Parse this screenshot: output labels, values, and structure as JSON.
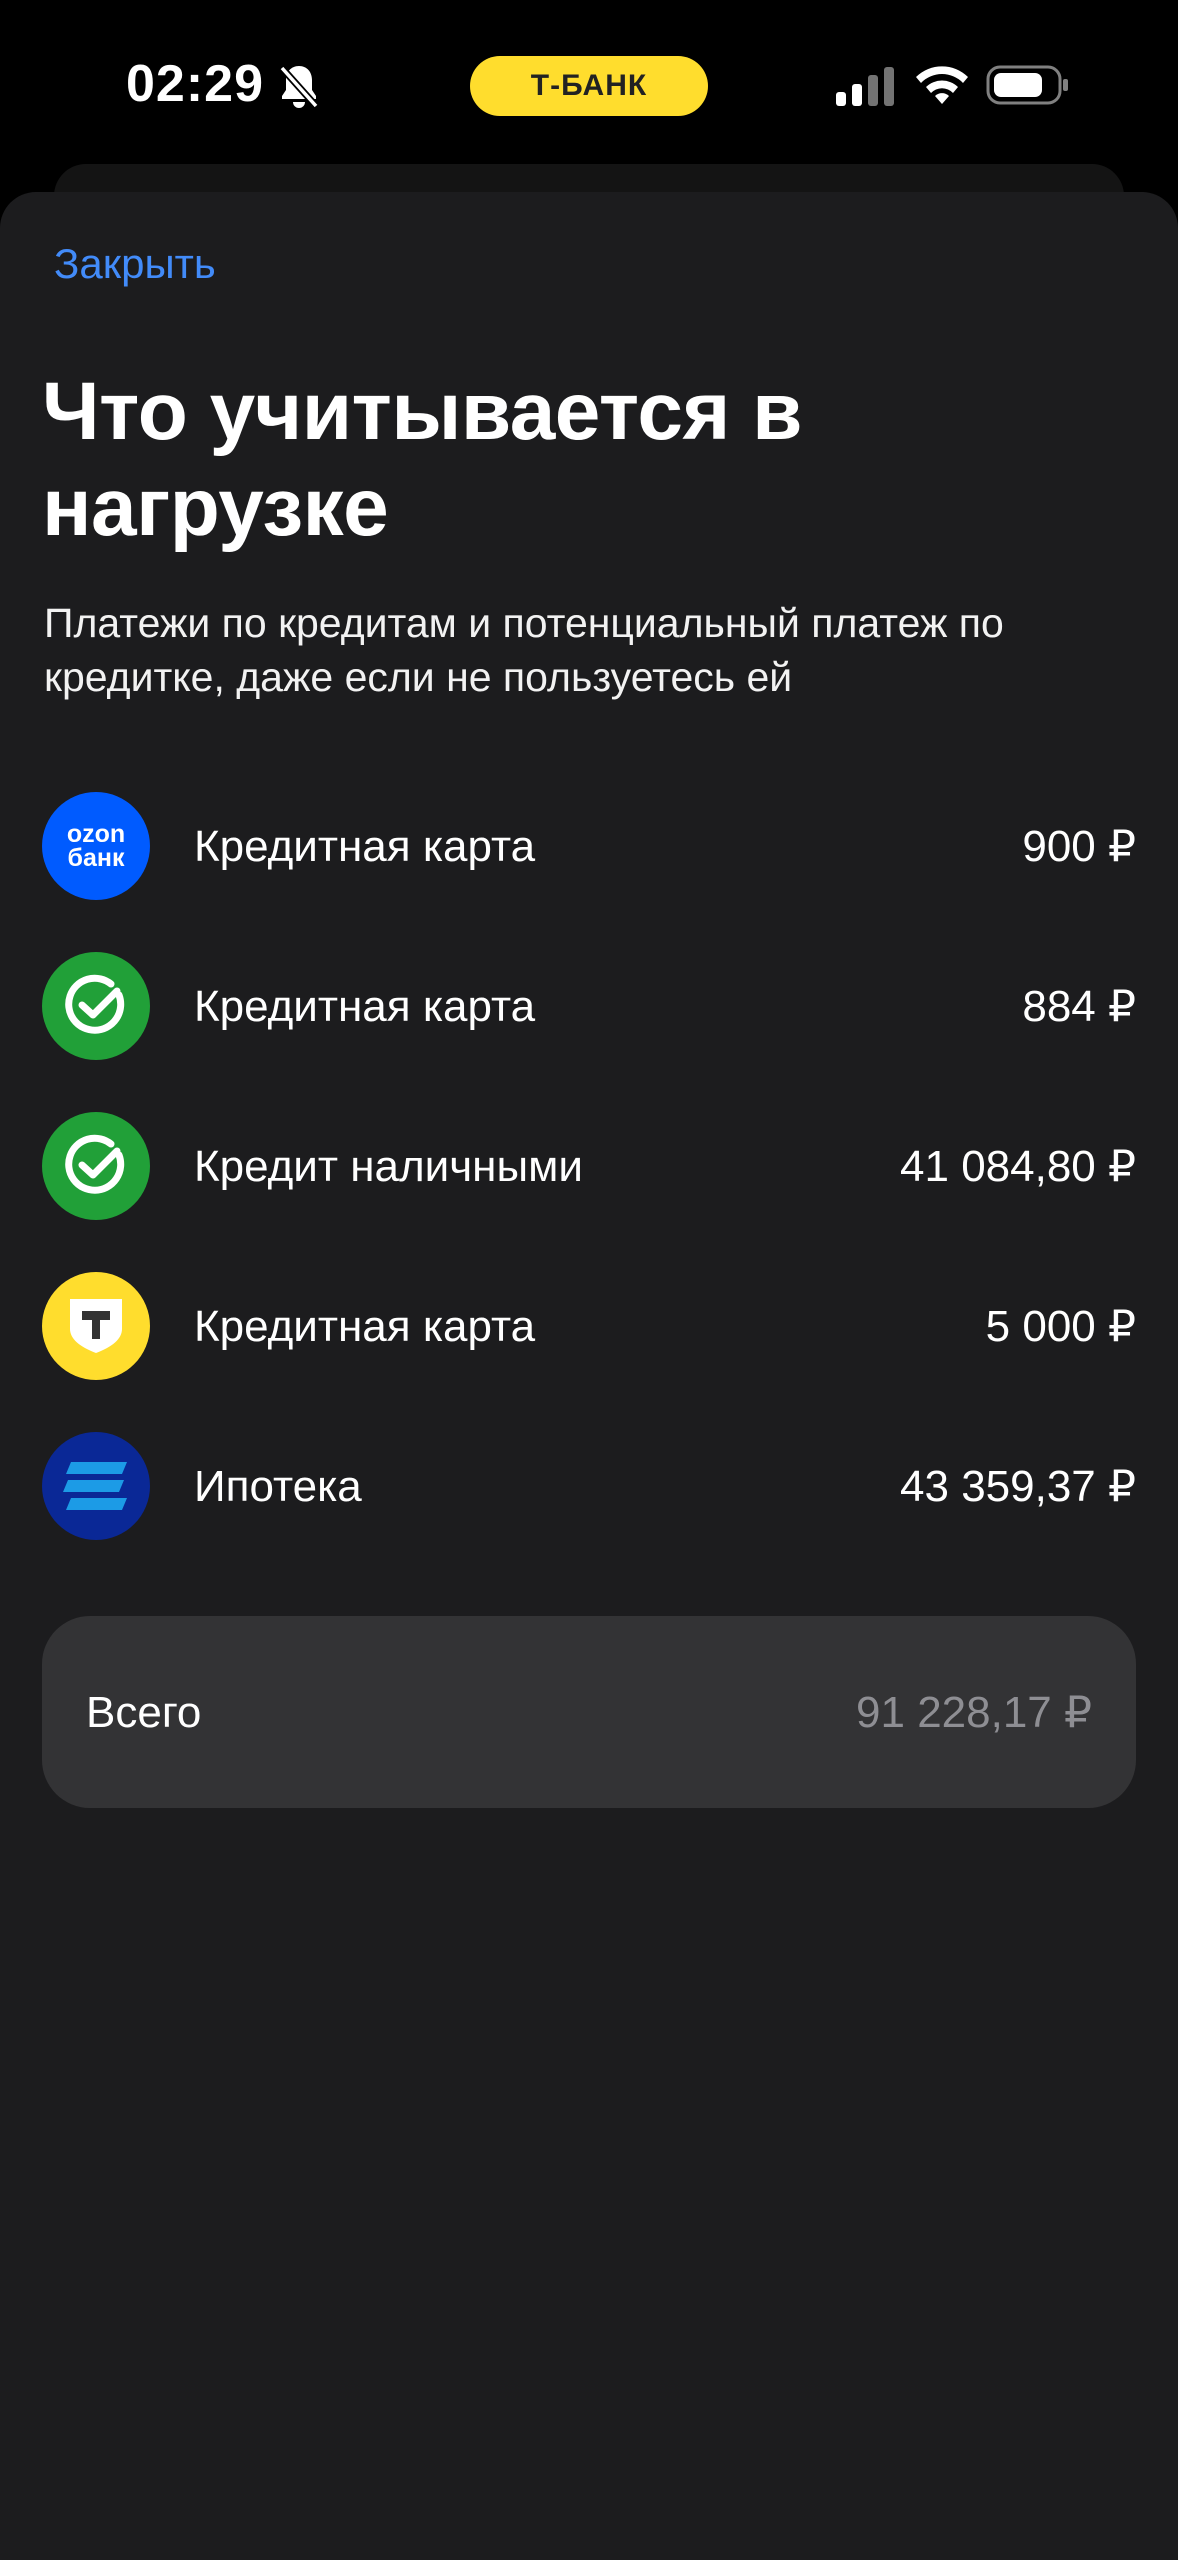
{
  "status_bar": {
    "time": "02:29",
    "bank_pill": "Т-БАНК",
    "icons": [
      "bell-off-icon",
      "cellular-signal-icon",
      "wifi-icon",
      "battery-icon"
    ]
  },
  "sheet": {
    "close_label": "Закрыть",
    "title": "Что учитывается в нагрузке",
    "subtitle": "Платежи по кредитам и потенциальный платеж по кредитке, даже если не пользуетесь ей",
    "items": [
      {
        "bank": "ozon-bank",
        "logo_text": "ozon банк",
        "label": "Кредитная карта",
        "amount": "900 ₽"
      },
      {
        "bank": "sber",
        "label": "Кредитная карта",
        "amount": "884 ₽"
      },
      {
        "bank": "sber",
        "label": "Кредит наличными",
        "amount": "41 084,80 ₽"
      },
      {
        "bank": "t-bank",
        "label": "Кредитная карта",
        "amount": "5 000 ₽"
      },
      {
        "bank": "vtb",
        "label": "Ипотека",
        "amount": "43 359,37 ₽"
      }
    ],
    "total": {
      "label": "Всего",
      "amount": "91 228,17 ₽"
    }
  },
  "colors": {
    "background": "#1c1c1e",
    "accent_link": "#428bf9",
    "tbank_yellow": "#ffdd2d",
    "ozon_blue": "#005bff",
    "sber_green": "#21a038",
    "vtb_blue": "#0a2896",
    "total_card": "#333335",
    "muted_text": "#8e8e93"
  }
}
